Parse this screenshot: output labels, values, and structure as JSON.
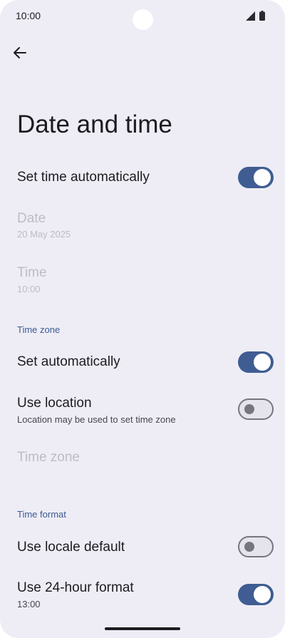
{
  "status_bar": {
    "time": "10:00",
    "signal_icon": "signal-icon",
    "battery_icon": "battery-icon"
  },
  "toolbar": {
    "back_icon": "arrow-back-icon"
  },
  "page": {
    "title": "Date and time"
  },
  "set_time_automatically": {
    "label": "Set time automatically",
    "enabled": true
  },
  "date": {
    "label": "Date",
    "value": "20 May 2025",
    "disabled": true
  },
  "time": {
    "label": "Time",
    "value": "10:00",
    "disabled": true
  },
  "time_zone_section": {
    "header": "Time zone",
    "set_automatically": {
      "label": "Set automatically",
      "enabled": true
    },
    "use_location": {
      "label": "Use location",
      "summary": "Location may be used to set time zone",
      "enabled": false
    },
    "time_zone": {
      "label": "Time zone",
      "disabled": true
    }
  },
  "time_format_section": {
    "header": "Time format",
    "use_locale_default": {
      "label": "Use locale default",
      "enabled": false
    },
    "use_24_hour": {
      "label": "Use 24-hour format",
      "summary": "13:00",
      "enabled": true
    }
  },
  "colors": {
    "background": "#eeedf5",
    "accent": "#3f5d92",
    "section_header": "#3d5a94",
    "disabled_text": "#bcbcc4"
  }
}
